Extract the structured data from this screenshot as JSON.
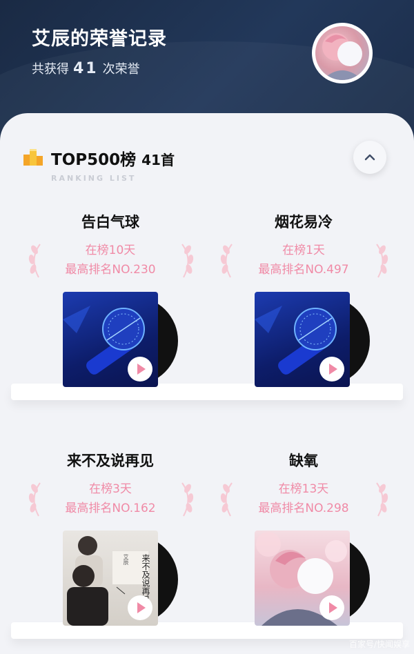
{
  "header": {
    "title": "艾辰的荣誉记录",
    "subtitle_prefix": "共获得",
    "subtitle_count": "41",
    "subtitle_suffix": "次荣誉"
  },
  "section": {
    "title": "TOP500榜",
    "count": "41首",
    "subtitle": "RANKING LIST"
  },
  "songs": [
    {
      "name": "告白气球",
      "days": "在榜10天",
      "rank": "最高排名NO.230",
      "cover": "microphone"
    },
    {
      "name": "烟花易冷",
      "days": "在榜1天",
      "rank": "最高排名NO.497",
      "cover": "microphone"
    },
    {
      "name": "来不及说再见",
      "days": "在榜3天",
      "rank": "最高排名NO.162",
      "cover": "photo"
    },
    {
      "name": "缺氧",
      "days": "在榜13天",
      "rank": "最高排名NO.298",
      "cover": "anime"
    }
  ],
  "cover_text": {
    "album_title": "来不及说再见",
    "artist": "艾辰"
  },
  "watermark": "百家号/快闻娱享",
  "colors": {
    "accent_pink": "#f08aa6",
    "header_bg": "#1c2c46",
    "card_bg": "#f2f3f7"
  }
}
